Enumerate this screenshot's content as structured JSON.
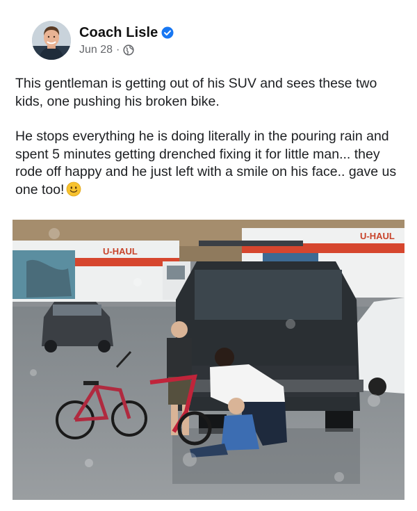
{
  "post": {
    "author": "Coach Lisle",
    "date": "Jun 28",
    "separator": "·",
    "paragraphs": [
      "This gentleman is getting out of his SUV and sees these two kids, one pushing his broken bike.",
      "He stops everything he is doing literally in the pouring rain and spent 5 minutes getting drenched fixing it for little man... they rode off happy and he just left with a smile on his face.. gave us one too!"
    ]
  },
  "photo": {
    "truck_left_brand": "U-HAUL",
    "truck_right_brand": "U-HAUL"
  },
  "icons": {
    "verified": "verified-badge-icon",
    "audience": "globe-icon",
    "emoji": "smiling-face-emoji"
  },
  "colors": {
    "verified_blue": "#1877f2",
    "meta_gray": "#65676b",
    "uhaul_orange": "#e8572a"
  }
}
